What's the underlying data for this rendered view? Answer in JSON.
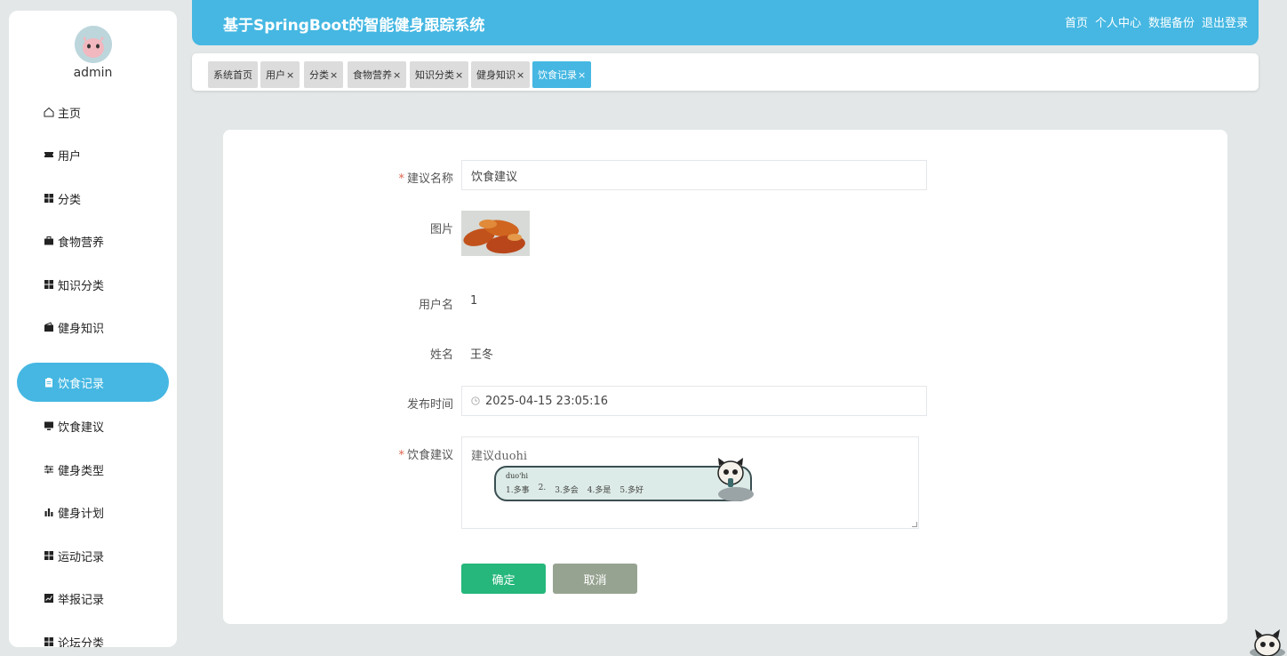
{
  "sidebar": {
    "username": "admin",
    "items": [
      {
        "label": "主页",
        "icon": "home-icon"
      },
      {
        "label": "用户",
        "icon": "ticket-icon"
      },
      {
        "label": "分类",
        "icon": "grid-icon"
      },
      {
        "label": "食物营养",
        "icon": "briefcase-icon"
      },
      {
        "label": "知识分类",
        "icon": "grid-icon"
      },
      {
        "label": "健身知识",
        "icon": "wallet-icon"
      },
      {
        "label": "饮食记录",
        "icon": "clipboard-icon",
        "active": true
      },
      {
        "label": "饮食建议",
        "icon": "monitor-icon"
      },
      {
        "label": "健身类型",
        "icon": "sliders-icon"
      },
      {
        "label": "健身计划",
        "icon": "bar-chart-icon"
      },
      {
        "label": "运动记录",
        "icon": "grid-icon"
      },
      {
        "label": "举报记录",
        "icon": "line-chart-icon"
      },
      {
        "label": "论坛分类",
        "icon": "grid-icon"
      }
    ]
  },
  "header": {
    "title": "基于SpringBoot的智能健身跟踪系统",
    "links": [
      "首页",
      "个人中心",
      "数据备份",
      "退出登录"
    ]
  },
  "tabs": [
    {
      "label": "系统首页",
      "closable": false
    },
    {
      "label": "用户",
      "closable": true
    },
    {
      "label": "分类",
      "closable": true
    },
    {
      "label": "食物营养",
      "closable": true
    },
    {
      "label": "知识分类",
      "closable": true
    },
    {
      "label": "健身知识",
      "closable": true
    },
    {
      "label": "饮食记录",
      "closable": true,
      "active": true
    }
  ],
  "close_glyph": "×",
  "form": {
    "suggestion_name": {
      "label": "建议名称",
      "required": true,
      "value": "饮食建议"
    },
    "image": {
      "label": "图片"
    },
    "username": {
      "label": "用户名",
      "value": "1"
    },
    "name": {
      "label": "姓名",
      "value": "王冬"
    },
    "publish_time": {
      "label": "发布时间",
      "value": "2025-04-15 23:05:16"
    },
    "diet_advice": {
      "label": "饮食建议",
      "required": true,
      "value": "建议duohi"
    },
    "required_mark": "*",
    "confirm_button": "确定",
    "cancel_button": "取消"
  },
  "ime": {
    "pinyin": "duo'hi",
    "candidates": [
      "1.多事",
      "2.",
      "3.多会",
      "4.多是",
      "5.多好"
    ]
  },
  "colors": {
    "accent": "#45b7e2",
    "confirm": "#25b77b",
    "cancel": "#97a391",
    "required": "#e0634d"
  }
}
